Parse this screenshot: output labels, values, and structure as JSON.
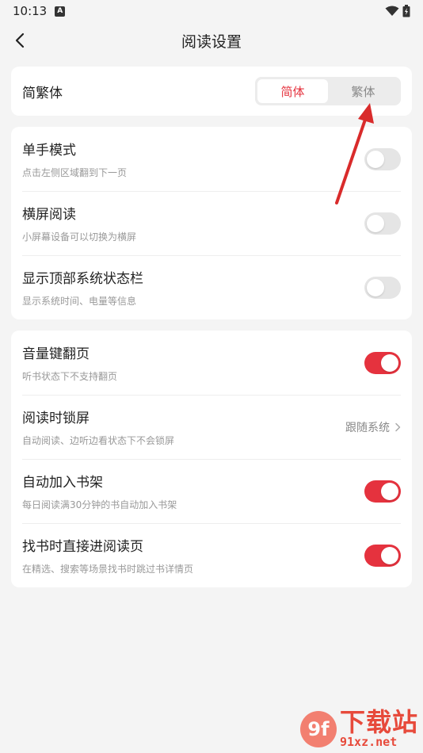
{
  "status_bar": {
    "time": "10:13",
    "notification_icon": "a-icon",
    "wifi_icon": "wifi-icon",
    "battery_icon": "battery-icon"
  },
  "navbar": {
    "title": "阅读设置",
    "back_icon": "chevron-left-icon"
  },
  "script_setting": {
    "label": "简繁体",
    "options": [
      "简体",
      "繁体"
    ],
    "selected": "简体"
  },
  "group1": [
    {
      "title": "单手模式",
      "subtitle": "点击左侧区域翻到下一页",
      "enabled": false
    },
    {
      "title": "横屏阅读",
      "subtitle": "小屏幕设备可以切换为横屏",
      "enabled": false
    },
    {
      "title": "显示顶部系统状态栏",
      "subtitle": "显示系统时间、电量等信息",
      "enabled": false
    }
  ],
  "group2": [
    {
      "title": "音量键翻页",
      "subtitle": "听书状态下不支持翻页",
      "enabled": true
    },
    {
      "title": "阅读时锁屏",
      "subtitle": "自动阅读、边听边看状态下不会锁屏",
      "value": "跟随系统"
    },
    {
      "title": "自动加入书架",
      "subtitle": "每日阅读满30分钟的书自动加入书架",
      "enabled": true
    },
    {
      "title": "找书时直接进阅读页",
      "subtitle": "在精选、搜索等场景找书时跳过书详情页",
      "enabled": true
    }
  ],
  "watermark": {
    "logo": "9f",
    "text": "下载站",
    "url": "91xz.net"
  },
  "colors": {
    "accent": "#e5323e",
    "toggle_off": "#e5e5e5",
    "background": "#f4f4f4",
    "annotation_arrow": "#d92b2b"
  }
}
